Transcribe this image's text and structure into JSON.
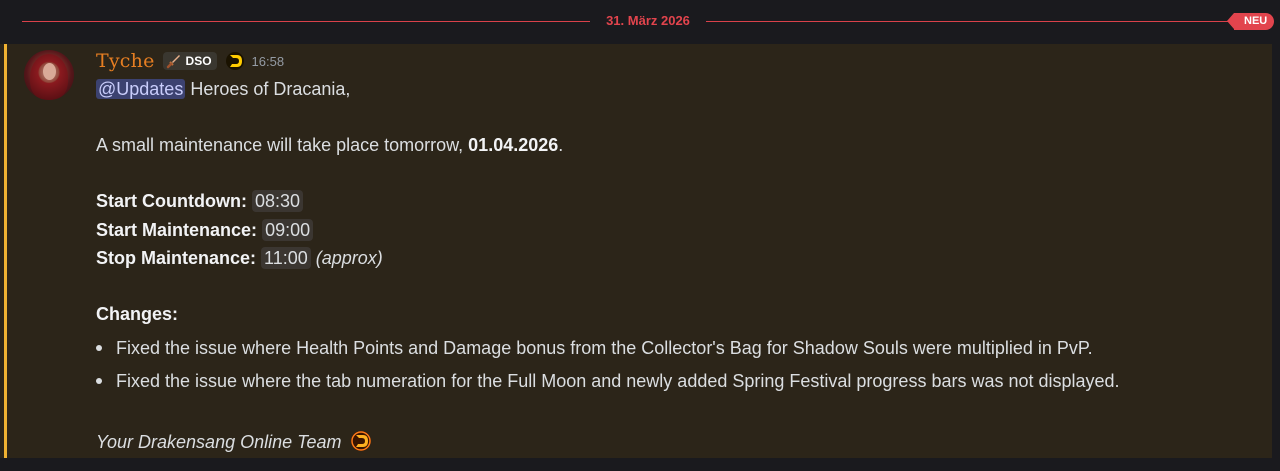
{
  "divider": {
    "date": "31. März 2026",
    "new_badge": "NEU"
  },
  "message": {
    "author": "Tyche",
    "tag": "DSO",
    "timestamp": "16:58",
    "mention": "@Updates",
    "greeting": " Heroes of Dracania,",
    "intro_text": "A small maintenance will take place tomorrow, ",
    "intro_date": "01.04.2026",
    "intro_end": ".",
    "schedule": [
      {
        "label": "Start Countdown:",
        "time": "08:30",
        "note": ""
      },
      {
        "label": "Start Maintenance:",
        "time": "09:00",
        "note": ""
      },
      {
        "label": "Stop Maintenance:",
        "time": "11:00",
        "note": "(approx)"
      }
    ],
    "changes_heading": "Changes:",
    "changes": [
      "Fixed the issue where Health Points and Damage bonus from the Collector's Bag for Shadow Souls were multiplied in PvP.",
      "Fixed the issue where the tab numeration for the Full Moon and newly added Spring Festival progress bars was not displayed."
    ],
    "signature": "Your Drakensang Online Team"
  },
  "colors": {
    "accent_red": "#e2444d",
    "author": "#e67e22",
    "mention_bar": "#f0b232",
    "message_bg": "#2c2519"
  },
  "icons": [
    "sword-icon",
    "drakensang-icon",
    "drakensang-emoji-icon"
  ]
}
